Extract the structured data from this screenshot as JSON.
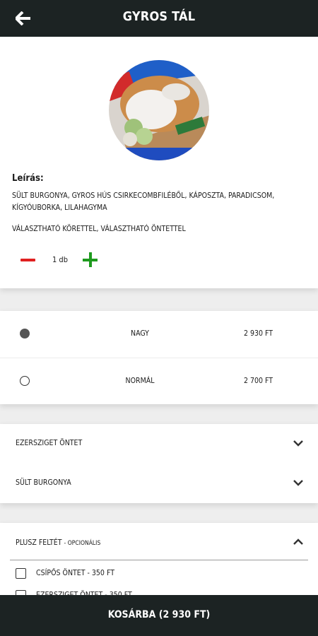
{
  "header": {
    "title": "GYROS TÁL",
    "back_icon": "arrow-left-icon"
  },
  "product": {
    "description_heading": "Leírás:",
    "description": "Sült burgonya, gyros hús csirkecombfiléből, káposzta, paradicsom, kígyóuborka, lilahagyma",
    "note": "Választható körettel, választható öntettel",
    "quantity": "1 db"
  },
  "sizes": [
    {
      "name": "Nagy",
      "price": "2 930 Ft",
      "selected": true
    },
    {
      "name": "Normál",
      "price": "2 700 Ft",
      "selected": false
    }
  ],
  "options": [
    {
      "label": "Ezersziget öntet",
      "icon": "chevron-down-icon"
    },
    {
      "label": "Sült burgonya",
      "icon": "chevron-down-icon"
    }
  ],
  "extras": {
    "title": "Plusz feltét",
    "subtitle": "- opcionális",
    "icon": "chevron-up-icon",
    "items": [
      {
        "label": "Csípős öntet - 350 Ft",
        "checked": false
      },
      {
        "label": "Ezersziget öntet - 350 Ft",
        "checked": false
      }
    ]
  },
  "cart": {
    "label": "Kosárba (2 930 Ft)"
  },
  "colors": {
    "bar": "#1c2323",
    "minus": "#e02020",
    "plus": "#1e9a1e"
  }
}
